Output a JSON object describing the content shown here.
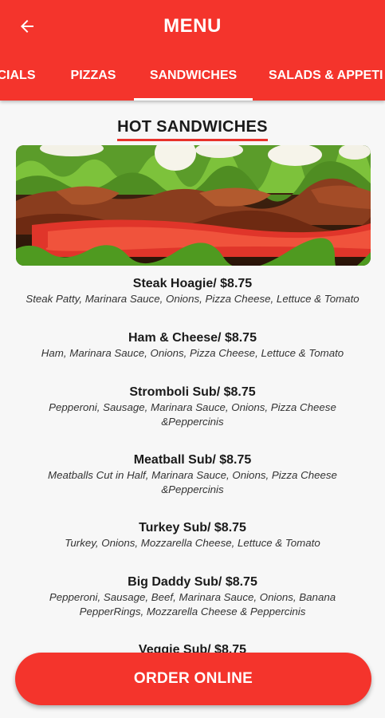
{
  "header": {
    "title": "MENU",
    "back_icon": "arrow-left-icon"
  },
  "tabs": [
    {
      "label": "CIALS"
    },
    {
      "label": "PIZZAS"
    },
    {
      "label": "SANDWICHES",
      "active": true
    },
    {
      "label": "SALADS & APPETI"
    }
  ],
  "section": {
    "title": "HOT SANDWICHES"
  },
  "items": [
    {
      "name": "Steak Hoagie/ $8.75",
      "desc": [
        "Steak Patty, Marinara Sauce, Onions, Pizza Cheese, Lettuce & Tomato"
      ]
    },
    {
      "name": "Ham & Cheese/ $8.75",
      "desc": [
        "Ham, Marinara Sauce, Onions, Pizza Cheese, Lettuce & Tomato"
      ]
    },
    {
      "name": "Stromboli Sub/ $8.75",
      "desc": [
        "Pepperoni, Sausage, Marinara Sauce, Onions, Pizza Cheese",
        "&Peppercinis"
      ]
    },
    {
      "name": "Meatball Sub/ $8.75",
      "desc": [
        "Meatballs Cut in Half, Marinara Sauce, Onions, Pizza Cheese",
        "&Peppercinis"
      ]
    },
    {
      "name": "Turkey Sub/ $8.75",
      "desc": [
        "Turkey, Onions, Mozzarella Cheese, Lettuce & Tomato"
      ]
    },
    {
      "name": "Big Daddy Sub/ $8.75",
      "desc": [
        "Pepperoni, Sausage, Beef, Marinara Sauce, Onions, Banana",
        "PepperRings, Mozzarella Cheese & Peppercinis"
      ]
    },
    {
      "name": "Veggie Sub/ $8.75",
      "desc": []
    }
  ],
  "order_button": {
    "label": "ORDER ONLINE"
  },
  "colors": {
    "accent": "#f4342c",
    "underline": "#e8322b",
    "background": "#f7f7f7"
  }
}
